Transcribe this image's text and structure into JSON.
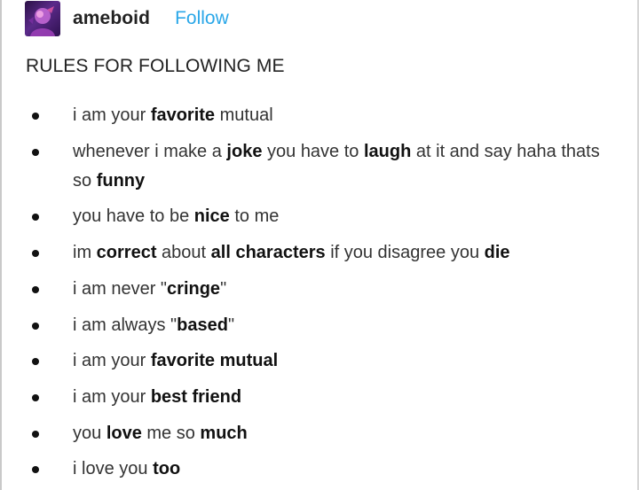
{
  "header": {
    "username": "ameboid",
    "follow_label": "Follow",
    "accent_color": "#2aa7e8"
  },
  "avatar": {
    "icon": "user-avatar-icon"
  },
  "post": {
    "title": "RULES FOR FOLLOWING ME"
  },
  "rules": [
    {
      "segments": [
        {
          "t": "i am your ",
          "b": false
        },
        {
          "t": "favorite",
          "b": true
        },
        {
          "t": " mutual",
          "b": false
        }
      ]
    },
    {
      "segments": [
        {
          "t": "whenever i make a ",
          "b": false
        },
        {
          "t": "joke",
          "b": true
        },
        {
          "t": " you have to ",
          "b": false
        },
        {
          "t": "laugh",
          "b": true
        },
        {
          "t": " at it and say haha thats so ",
          "b": false
        },
        {
          "t": "funny",
          "b": true
        }
      ]
    },
    {
      "segments": [
        {
          "t": "you have to be ",
          "b": false
        },
        {
          "t": "nice",
          "b": true
        },
        {
          "t": " to me",
          "b": false
        }
      ]
    },
    {
      "segments": [
        {
          "t": "im ",
          "b": false
        },
        {
          "t": "correct",
          "b": true
        },
        {
          "t": " about ",
          "b": false
        },
        {
          "t": "all characters",
          "b": true
        },
        {
          "t": " if you disagree you ",
          "b": false
        },
        {
          "t": "die",
          "b": true
        }
      ]
    },
    {
      "segments": [
        {
          "t": "i am never \"",
          "b": false
        },
        {
          "t": "cringe",
          "b": true
        },
        {
          "t": "\"",
          "b": false
        }
      ]
    },
    {
      "segments": [
        {
          "t": "i am always \"",
          "b": false
        },
        {
          "t": "based",
          "b": true
        },
        {
          "t": "\"",
          "b": false
        }
      ]
    },
    {
      "segments": [
        {
          "t": "i am your ",
          "b": false
        },
        {
          "t": "favorite mutual",
          "b": true
        }
      ]
    },
    {
      "segments": [
        {
          "t": "i am your ",
          "b": false
        },
        {
          "t": "best friend",
          "b": true
        }
      ]
    },
    {
      "segments": [
        {
          "t": "you ",
          "b": false
        },
        {
          "t": "love",
          "b": true
        },
        {
          "t": " me so ",
          "b": false
        },
        {
          "t": "much",
          "b": true
        }
      ]
    },
    {
      "segments": [
        {
          "t": "i love you ",
          "b": false
        },
        {
          "t": "too",
          "b": true
        }
      ]
    }
  ]
}
